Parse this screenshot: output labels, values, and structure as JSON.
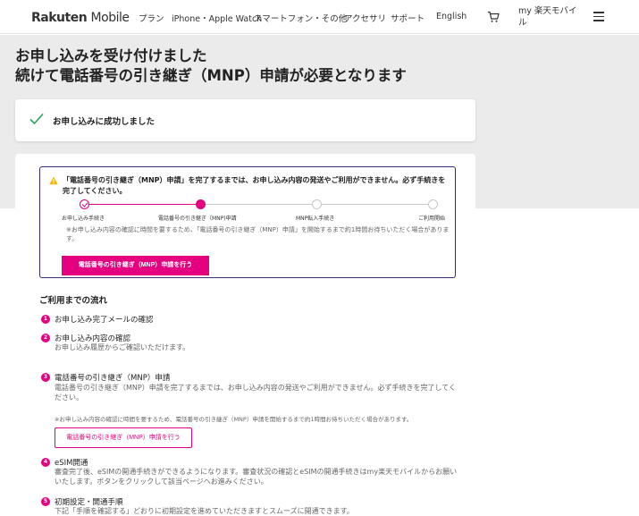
{
  "header": {
    "logo_brand": "Rakuten",
    "logo_product": "Mobile",
    "nav": [
      "プラン",
      "iPhone・Apple Watch",
      "スマートフォン・その他",
      "アクセサリ",
      "サポート",
      "English"
    ],
    "account_label": "my 楽天モバイル"
  },
  "page": {
    "title_line1": "お申し込みを受け付けました",
    "title_line2": "続けて電話番号の引き継ぎ（MNP）申請が必要となります"
  },
  "success": {
    "text": "お申し込みに成功しました"
  },
  "alert": {
    "text": "「電話番号の引き継ぎ（MNP）申請」を完了するまでは、お申し込み内容の発送やご利用ができません。必ず手続きを完了してください。",
    "steps": [
      {
        "label": "お申し込み手続き",
        "state": "done"
      },
      {
        "label": "電話番号の引き継ぎ（MNP)申請",
        "state": "current"
      },
      {
        "label": "MNP転入手続き",
        "state": "todo"
      },
      {
        "label": "ご利用開始",
        "state": "todo"
      }
    ],
    "note": "※お申し込み内容の確認に時間を要するため、「電話番号の引き継ぎ（MNP）申請」を開始するまで約1時間お待ちいただく場合があります。",
    "button_label": "電話番号の引き継ぎ（MNP）申請を行う"
  },
  "flow": {
    "title": "ご利用までの流れ",
    "items": [
      {
        "num": "1",
        "title": "お申し込み完了メールの確認"
      },
      {
        "num": "2",
        "title": "お申し込み内容の確認",
        "desc": "お申し込み履歴からご確認いただけます。"
      },
      {
        "num": "3",
        "title": "電話番号の引き継ぎ（MNP）申請",
        "desc": "電話番号の引き継ぎ（MNP）申請を完了するまでは、お申し込み内容の発送やご利用ができません。必ず手続きを完了してください。",
        "note": "※お申し込み内容の確認に時間を要するため、電話番号の引き継ぎ（MNP）申請を開始するまで約1時間お待ちいただく場合があります。",
        "button_label": "電話番号の引き継ぎ（MNP）申請を行う"
      },
      {
        "num": "4",
        "title": "eSIM開通",
        "desc": "審査完了後、eSIMの開通手続きができるようになります。審査状況の確認とeSIMの開通手続きはmy楽天モバイルからお願いいたします。ボタンをクリックして該当ページへお進みください。"
      },
      {
        "num": "5",
        "title": "初期設定・開通手順",
        "desc": "下記「手順を確認する」どおりに初期設定を進めていただきますとスムーズに開通できます。"
      }
    ]
  },
  "colors": {
    "accent": "#e4007f",
    "alert_border": "#3b2a7a",
    "success_check": "#2e9e57",
    "warn": "#f5b800"
  },
  "icons": {
    "cart": "cart-icon",
    "menu": "hamburger-menu-icon",
    "check": "check-icon",
    "warning": "warning-icon"
  }
}
